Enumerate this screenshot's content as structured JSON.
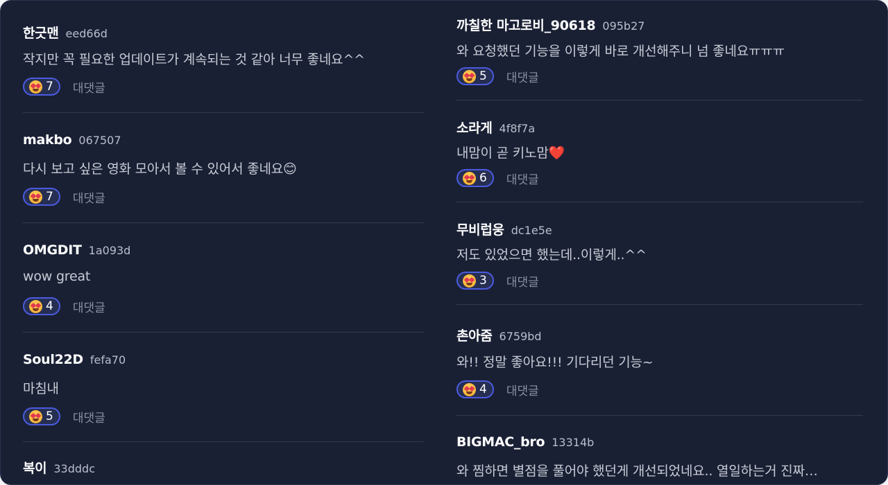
{
  "reply_label": "대댓글",
  "left_comments": [
    {
      "user": "한긋맨",
      "uid": "eed66d",
      "text": "작지만 꼭 필요한 업데이트가 계속되는 것 같아 너무 좋네요^^",
      "count": "7"
    },
    {
      "user": "makbo",
      "uid": "067507",
      "text": "다시 보고 싶은 영화 모아서 볼 수 있어서 좋네요😊",
      "count": "7"
    },
    {
      "user": "OMGDIT",
      "uid": "1a093d",
      "text": "wow great",
      "count": "4"
    },
    {
      "user": "Soul22D",
      "uid": "fefa70",
      "text": "마침내",
      "count": "5"
    },
    {
      "user": "복이",
      "uid": "33dddc",
      "text": "",
      "count": ""
    }
  ],
  "right_comments": [
    {
      "user": "까칠한 마고로비_90618",
      "uid": "095b27",
      "text": "와 요청했던 기능을 이렇게 바로 개선해주니 넘 좋네요ㅠㅠㅠ",
      "count": "5"
    },
    {
      "user": "소라게",
      "uid": "4f8f7a",
      "text": "내맘이 곧 키노맘❤️",
      "count": "6"
    },
    {
      "user": "무비럽웅",
      "uid": "dc1e5e",
      "text": "저도 있었으면 했는데..이렇게..^^",
      "count": "3"
    },
    {
      "user": "촌아줌",
      "uid": "6759bd",
      "text": "와!! 정말 좋아요!!! 기다리던 기능~",
      "count": "4"
    },
    {
      "user": "BIGMAC_bro",
      "uid": "13314b",
      "text": "와 찜하면 별점을 풀어야 했던게 개선되었네요.. 열일하는거 진짜…",
      "count": ""
    }
  ],
  "colors": {
    "background": "#1a2034",
    "accent": "#4b5be0",
    "divider": "#313852"
  },
  "icons": {
    "reaction": "heart-eyes-emoji-icon"
  }
}
